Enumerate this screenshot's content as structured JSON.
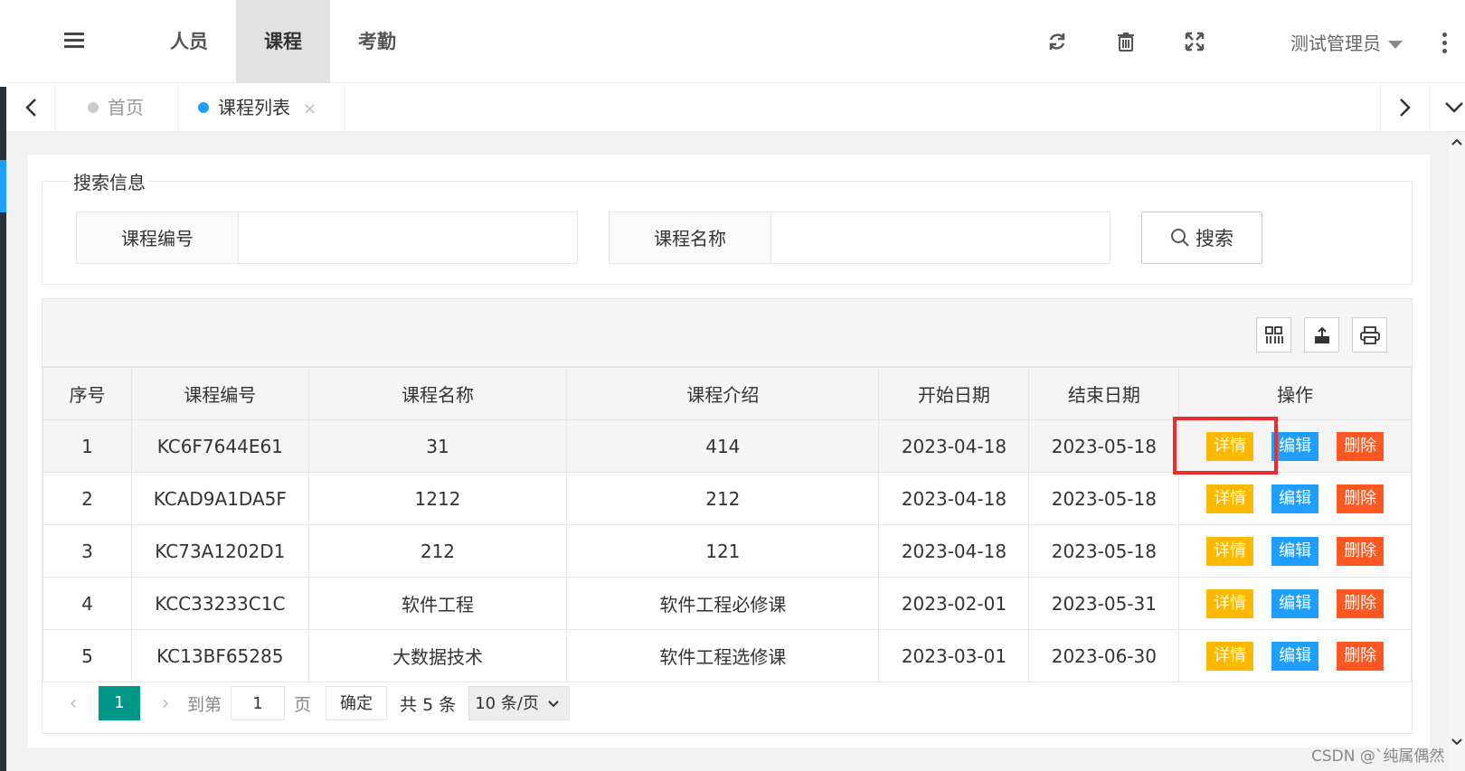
{
  "header": {
    "nav": [
      {
        "label": "人员",
        "active": false
      },
      {
        "label": "课程",
        "active": true
      },
      {
        "label": "考勤",
        "active": false
      }
    ],
    "user": "测试管理员"
  },
  "tabs": [
    {
      "label": "首页",
      "active": false
    },
    {
      "label": "课程列表",
      "active": true,
      "close": "×"
    }
  ],
  "search": {
    "legend": "搜索信息",
    "course_no_label": "课程编号",
    "course_no_value": "",
    "course_name_label": "课程名称",
    "course_name_value": "",
    "button_label": "搜索"
  },
  "table": {
    "columns": [
      "序号",
      "课程编号",
      "课程名称",
      "课程介绍",
      "开始日期",
      "结束日期",
      "操作"
    ],
    "rows": [
      {
        "no": "1",
        "code": "KC6F7644E61",
        "name": "31",
        "intro": "414",
        "start": "2023-04-18",
        "end": "2023-05-18"
      },
      {
        "no": "2",
        "code": "KCAD9A1DA5F",
        "name": "1212",
        "intro": "212",
        "start": "2023-04-18",
        "end": "2023-05-18"
      },
      {
        "no": "3",
        "code": "KC73A1202D1",
        "name": "212",
        "intro": "121",
        "start": "2023-04-18",
        "end": "2023-05-18"
      },
      {
        "no": "4",
        "code": "KCC33233C1C",
        "name": "软件工程",
        "intro": "软件工程必修课",
        "start": "2023-02-01",
        "end": "2023-05-31"
      },
      {
        "no": "5",
        "code": "KC13BF65285",
        "name": "大数据技术",
        "intro": "软件工程选修课",
        "start": "2023-03-01",
        "end": "2023-06-30"
      }
    ],
    "actions": {
      "detail": "详情",
      "edit": "编辑",
      "delete": "删除"
    }
  },
  "pager": {
    "current": "1",
    "goto_label": "到第",
    "goto_value": "1",
    "page_label": "页",
    "ok_label": "确定",
    "total": "共 5 条",
    "page_size": "10 条/页"
  },
  "watermark": "CSDN @`纯属偶然",
  "colors": {
    "primary": "#009688",
    "detail": "#ffb800",
    "edit": "#1e9fff",
    "delete": "#ff5722",
    "highlight": "#f02b2b"
  }
}
